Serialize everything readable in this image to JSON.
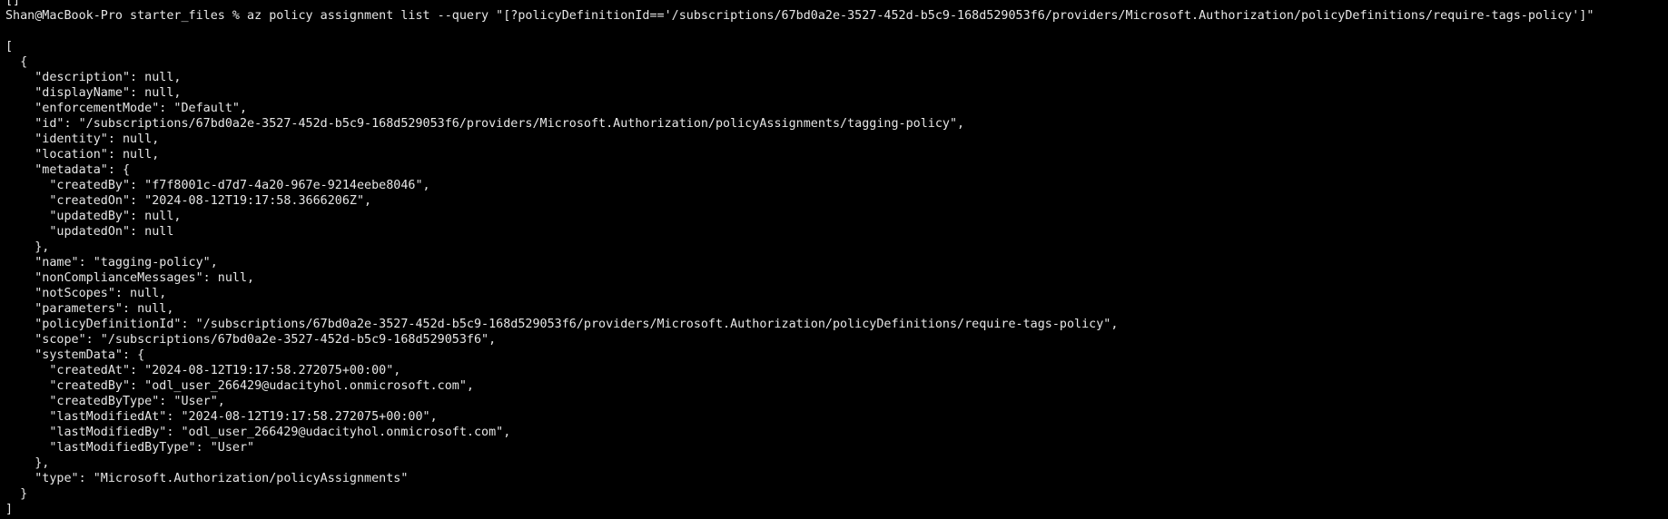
{
  "terminal": {
    "lines": [
      "[]",
      "Shan@MacBook-Pro starter_files % az policy assignment list --query \"[?policyDefinitionId=='/subscriptions/67bd0a2e-3527-452d-b5c9-168d529053f6/providers/Microsoft.Authorization/policyDefinitions/require-tags-policy']\"",
      "",
      "[",
      "  {",
      "    \"description\": null,",
      "    \"displayName\": null,",
      "    \"enforcementMode\": \"Default\",",
      "    \"id\": \"/subscriptions/67bd0a2e-3527-452d-b5c9-168d529053f6/providers/Microsoft.Authorization/policyAssignments/tagging-policy\",",
      "    \"identity\": null,",
      "    \"location\": null,",
      "    \"metadata\": {",
      "      \"createdBy\": \"f7f8001c-d7d7-4a20-967e-9214eebe8046\",",
      "      \"createdOn\": \"2024-08-12T19:17:58.3666206Z\",",
      "      \"updatedBy\": null,",
      "      \"updatedOn\": null",
      "    },",
      "    \"name\": \"tagging-policy\",",
      "    \"nonComplianceMessages\": null,",
      "    \"notScopes\": null,",
      "    \"parameters\": null,",
      "    \"policyDefinitionId\": \"/subscriptions/67bd0a2e-3527-452d-b5c9-168d529053f6/providers/Microsoft.Authorization/policyDefinitions/require-tags-policy\",",
      "    \"scope\": \"/subscriptions/67bd0a2e-3527-452d-b5c9-168d529053f6\",",
      "    \"systemData\": {",
      "      \"createdAt\": \"2024-08-12T19:17:58.272075+00:00\",",
      "      \"createdBy\": \"odl_user_266429@udacityhol.onmicrosoft.com\",",
      "      \"createdByType\": \"User\",",
      "      \"lastModifiedAt\": \"2024-08-12T19:17:58.272075+00:00\",",
      "      \"lastModifiedBy\": \"odl_user_266429@udacityhol.onmicrosoft.com\",",
      "      \"lastModifiedByType\": \"User\"",
      "    },",
      "    \"type\": \"Microsoft.Authorization/policyAssignments\"",
      "  }",
      "]"
    ]
  }
}
